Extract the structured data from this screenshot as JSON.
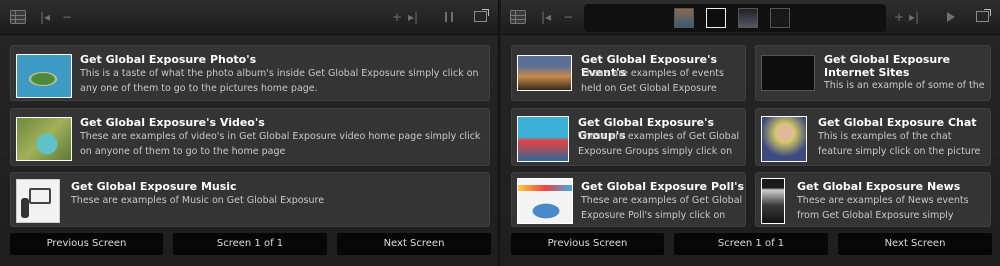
{
  "left_panel": {
    "cards": [
      {
        "title": "Get Global Exposure Photo's",
        "description": "This is a taste of what the photo album's inside Get Global Exposure simply click on any one of them to go to the pictures home page."
      },
      {
        "title": "Get Global Exposure's Video's",
        "description": "These are examples of video's in Get Global Exposure video home page simply click on anyone of them to go to the home page"
      },
      {
        "title": "Get Global Exposure Music",
        "description": "These are examples of Music on Get Global Exposure"
      }
    ],
    "nav": {
      "previous": "Previous Screen",
      "screen": "Screen 1 of 1",
      "next": "Next Screen"
    }
  },
  "right_panel": {
    "cards": [
      {
        "title": "Get Global Exposure's Event's",
        "description": "These are examples of events held on Get Global Exposure simply"
      },
      {
        "title": "Get Global Exposure Internet Sites",
        "description": "This is an example of some of the"
      },
      {
        "title": "Get Global Exposure's Group's",
        "description": "These are examples of Get Global Exposure Groups simply click on"
      },
      {
        "title": "Get Global Exposure Chat",
        "description": "This is examples of the chat feature simply click on the picture to be"
      },
      {
        "title": "Get Global Exposure Poll's",
        "description": "These are examples of Get Global Exposure Poll's simply click on the"
      },
      {
        "title": "Get Global Exposure News",
        "description": "These are examples of News events from Get Global Exposure simply"
      }
    ],
    "nav": {
      "previous": "Previous Screen",
      "screen": "Screen 1 of 1",
      "next": "Next Screen"
    }
  },
  "toolbar_glyphs": {
    "skip_back": "|◂",
    "minus": "−",
    "plus": "+",
    "skip_forward": "▸|"
  }
}
